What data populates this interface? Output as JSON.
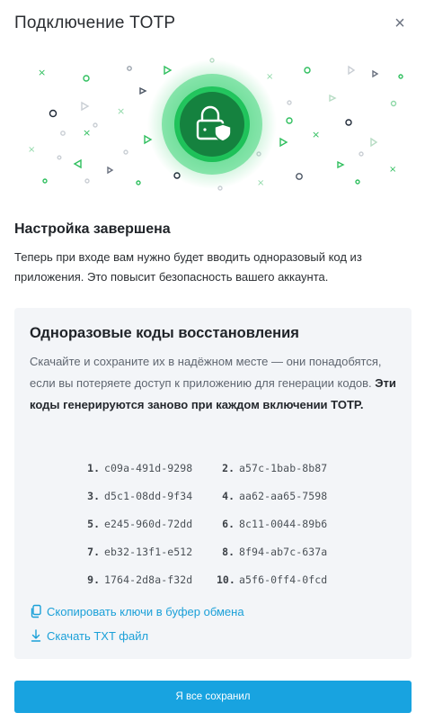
{
  "header": {
    "title": "Подключение TOTP",
    "close_label": "×"
  },
  "hero": {
    "icons": [
      "lock-shield-icon"
    ],
    "accent": "#1ec25a"
  },
  "complete": {
    "title": "Настройка завершена",
    "text": "Теперь при входе вам нужно будет вводить одноразовый код из приложения. Это повысит безопасность вашего аккаунта."
  },
  "recovery": {
    "title": "Одноразовые коды восстановления",
    "text": "Скачайте и сохраните их в надёжном месте — они понадобятся, если вы потеряете доступ к приложению для генерации кодов.",
    "text_bold": "Эти коды генерируются заново при каждом включении TOTP.",
    "codes": [
      {
        "num": "1.",
        "code": "c09a-491d-9298"
      },
      {
        "num": "2.",
        "code": "a57c-1bab-8b87"
      },
      {
        "num": "3.",
        "code": "d5c1-08dd-9f34"
      },
      {
        "num": "4.",
        "code": "aa62-aa65-7598"
      },
      {
        "num": "5.",
        "code": "e245-960d-72dd"
      },
      {
        "num": "6.",
        "code": "8c11-0044-89b6"
      },
      {
        "num": "7.",
        "code": "eb32-13f1-e512"
      },
      {
        "num": "8.",
        "code": "8f94-ab7c-637a"
      },
      {
        "num": "9.",
        "code": "1764-2d8a-f32d"
      },
      {
        "num": "10.",
        "code": "a5f6-0ff4-0fcd"
      }
    ],
    "copy_label": "Скопировать ключи в буфер обмена",
    "download_label": "Скачать TXT файл"
  },
  "actions": {
    "confirm_label": "Я все сохранил"
  },
  "colors": {
    "link": "#1ba0d8",
    "button": "#18a3e0",
    "card_bg": "#f3f5f8"
  }
}
